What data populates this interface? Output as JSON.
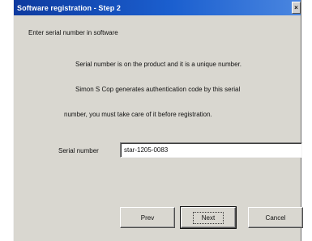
{
  "window": {
    "title": "Software registration - Step 2",
    "close_glyph": "×"
  },
  "content": {
    "instruction": "Enter serial number in software",
    "para_line1": "Serial number is on the product and it is a unique number.",
    "para_line2": "Simon S Cop generates authentication code by this serial",
    "para_line3": "number, you must take care of it before registration."
  },
  "serial": {
    "label": "Serial number",
    "value": "star-1205-0083"
  },
  "buttons": {
    "prev": "Prev",
    "next": "Next",
    "cancel": "Cancel"
  }
}
